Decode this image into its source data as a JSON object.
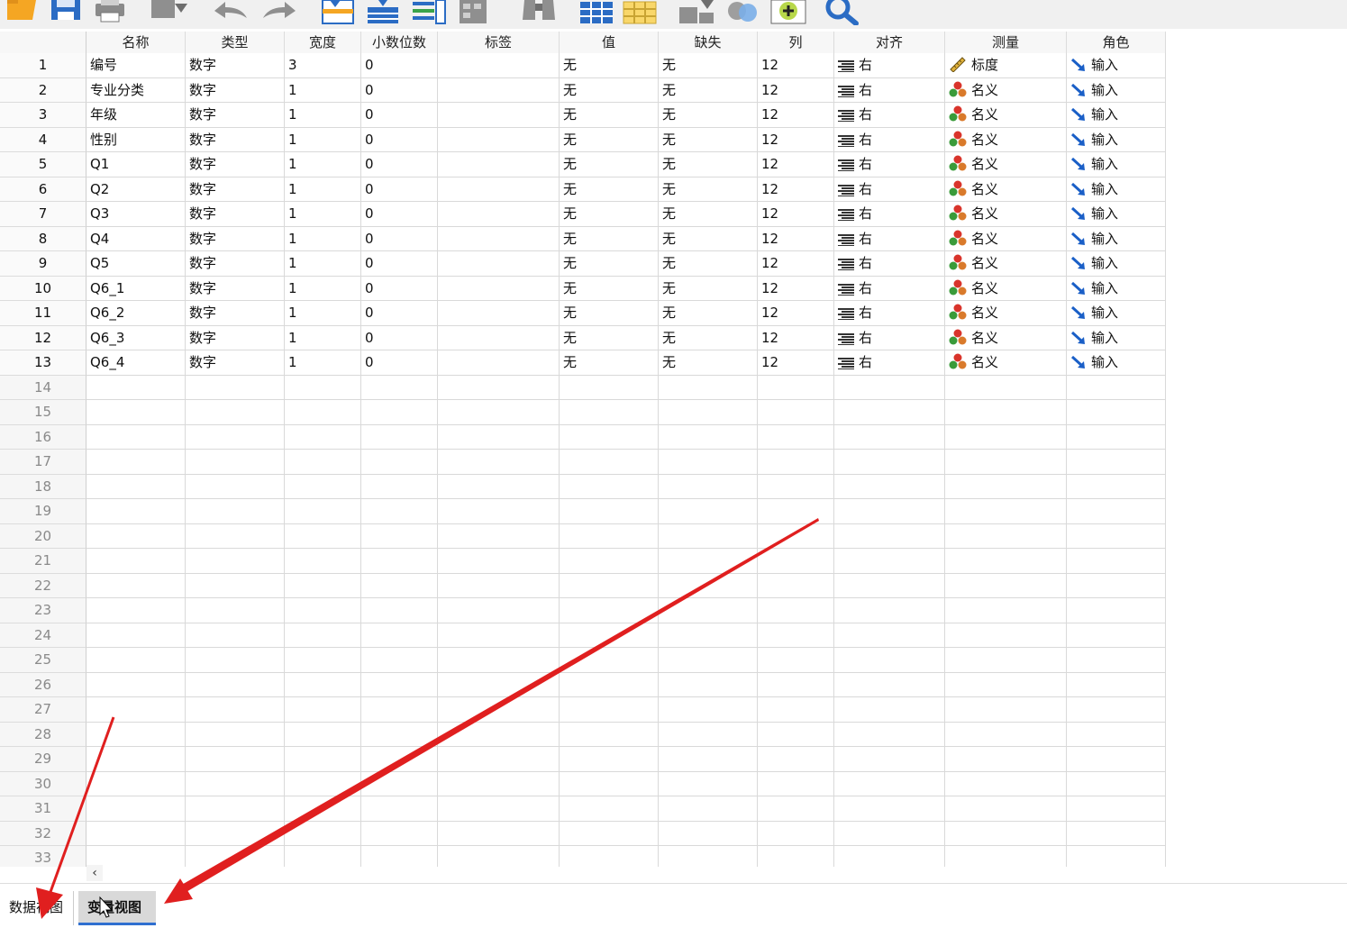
{
  "columns": [
    "名称",
    "类型",
    "宽度",
    "小数位数",
    "标签",
    "值",
    "缺失",
    "列",
    "对齐",
    "测量",
    "角色"
  ],
  "variables": [
    {
      "num": "1",
      "name": "编号",
      "type": "数字",
      "width": "3",
      "decimals": "0",
      "label": "",
      "values": "无",
      "missing": "无",
      "columns": "12",
      "align": "右",
      "measure": "标度",
      "measure_icon": "ruler-icon",
      "role": "输入"
    },
    {
      "num": "2",
      "name": "专业分类",
      "type": "数字",
      "width": "1",
      "decimals": "0",
      "label": "",
      "values": "无",
      "missing": "无",
      "columns": "12",
      "align": "右",
      "measure": "名义",
      "measure_icon": "nominal-icon",
      "role": "输入"
    },
    {
      "num": "3",
      "name": "年级",
      "type": "数字",
      "width": "1",
      "decimals": "0",
      "label": "",
      "values": "无",
      "missing": "无",
      "columns": "12",
      "align": "右",
      "measure": "名义",
      "measure_icon": "nominal-icon",
      "role": "输入"
    },
    {
      "num": "4",
      "name": "性别",
      "type": "数字",
      "width": "1",
      "decimals": "0",
      "label": "",
      "values": "无",
      "missing": "无",
      "columns": "12",
      "align": "右",
      "measure": "名义",
      "measure_icon": "nominal-icon",
      "role": "输入"
    },
    {
      "num": "5",
      "name": "Q1",
      "type": "数字",
      "width": "1",
      "decimals": "0",
      "label": "",
      "values": "无",
      "missing": "无",
      "columns": "12",
      "align": "右",
      "measure": "名义",
      "measure_icon": "nominal-icon",
      "role": "输入"
    },
    {
      "num": "6",
      "name": "Q2",
      "type": "数字",
      "width": "1",
      "decimals": "0",
      "label": "",
      "values": "无",
      "missing": "无",
      "columns": "12",
      "align": "右",
      "measure": "名义",
      "measure_icon": "nominal-icon",
      "role": "输入"
    },
    {
      "num": "7",
      "name": "Q3",
      "type": "数字",
      "width": "1",
      "decimals": "0",
      "label": "",
      "values": "无",
      "missing": "无",
      "columns": "12",
      "align": "右",
      "measure": "名义",
      "measure_icon": "nominal-icon",
      "role": "输入"
    },
    {
      "num": "8",
      "name": "Q4",
      "type": "数字",
      "width": "1",
      "decimals": "0",
      "label": "",
      "values": "无",
      "missing": "无",
      "columns": "12",
      "align": "右",
      "measure": "名义",
      "measure_icon": "nominal-icon",
      "role": "输入"
    },
    {
      "num": "9",
      "name": "Q5",
      "type": "数字",
      "width": "1",
      "decimals": "0",
      "label": "",
      "values": "无",
      "missing": "无",
      "columns": "12",
      "align": "右",
      "measure": "名义",
      "measure_icon": "nominal-icon",
      "role": "输入"
    },
    {
      "num": "10",
      "name": "Q6_1",
      "type": "数字",
      "width": "1",
      "decimals": "0",
      "label": "",
      "values": "无",
      "missing": "无",
      "columns": "12",
      "align": "右",
      "measure": "名义",
      "measure_icon": "nominal-icon",
      "role": "输入"
    },
    {
      "num": "11",
      "name": "Q6_2",
      "type": "数字",
      "width": "1",
      "decimals": "0",
      "label": "",
      "values": "无",
      "missing": "无",
      "columns": "12",
      "align": "右",
      "measure": "名义",
      "measure_icon": "nominal-icon",
      "role": "输入"
    },
    {
      "num": "12",
      "name": "Q6_3",
      "type": "数字",
      "width": "1",
      "decimals": "0",
      "label": "",
      "values": "无",
      "missing": "无",
      "columns": "12",
      "align": "右",
      "measure": "名义",
      "measure_icon": "nominal-icon",
      "role": "输入"
    },
    {
      "num": "13",
      "name": "Q6_4",
      "type": "数字",
      "width": "1",
      "decimals": "0",
      "label": "",
      "values": "无",
      "missing": "无",
      "columns": "12",
      "align": "右",
      "measure": "名义",
      "measure_icon": "nominal-icon",
      "role": "输入"
    }
  ],
  "empty_rows": [
    "14",
    "15",
    "16",
    "17",
    "18",
    "19",
    "20",
    "21",
    "22",
    "23",
    "24",
    "25",
    "26",
    "27",
    "28",
    "29",
    "30",
    "31",
    "32",
    "33"
  ],
  "tabs": {
    "data_view": "数据视图",
    "variable_view": "变量视图"
  },
  "toolbar_icons": [
    "open-file-icon",
    "save-icon",
    "print-icon",
    "dialog-recall-icon",
    "undo-icon",
    "redo-icon",
    "goto-case-icon",
    "goto-variable-icon",
    "variables-icon",
    "find-icon",
    "binoculars-icon",
    "insert-cases-icon",
    "insert-variable-icon",
    "split-file-icon",
    "weight-cases-icon",
    "value-labels-icon",
    "add-icon",
    "search-icon"
  ],
  "colors": {
    "annotation_arrow": "#e01f1f",
    "active_tab_underline": "#2f6fd0",
    "role_arrow": "#1a5fc7"
  }
}
